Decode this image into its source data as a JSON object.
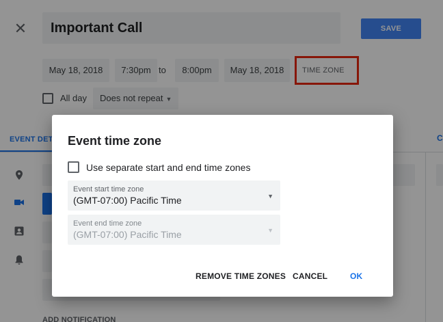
{
  "editor": {
    "title": "Important Call",
    "save_label": "SAVE",
    "start_date": "May 18, 2018",
    "start_time": "7:30pm",
    "to_label": "to",
    "end_time": "8:00pm",
    "end_date": "May 18, 2018",
    "time_zone_label": "TIME ZONE",
    "all_day_label": "All day",
    "repeat_value": "Does not repeat",
    "tab_event_details": "EVENT DET",
    "add_notification": "ADD NOTIFICATION",
    "accent_color": "#4285f4",
    "highlight_color": "#e8260f"
  },
  "dialog": {
    "title": "Event time zone",
    "separate_zones_label": "Use separate start and end time zones",
    "separate_zones_checked": false,
    "start_zone": {
      "label": "Event start time zone",
      "value": "(GMT-07:00) Pacific Time"
    },
    "end_zone": {
      "label": "Event end time zone",
      "value": "(GMT-07:00) Pacific Time",
      "disabled": true
    },
    "remove_label": "REMOVE TIME ZONES",
    "cancel_label": "CANCEL",
    "ok_label": "OK"
  },
  "icons": {
    "close": "close-icon",
    "location": "location-pin-icon",
    "video": "video-camera-icon",
    "calendar_user": "calendar-user-icon",
    "notification": "bell-icon",
    "dropdown": "chevron-down-icon"
  }
}
